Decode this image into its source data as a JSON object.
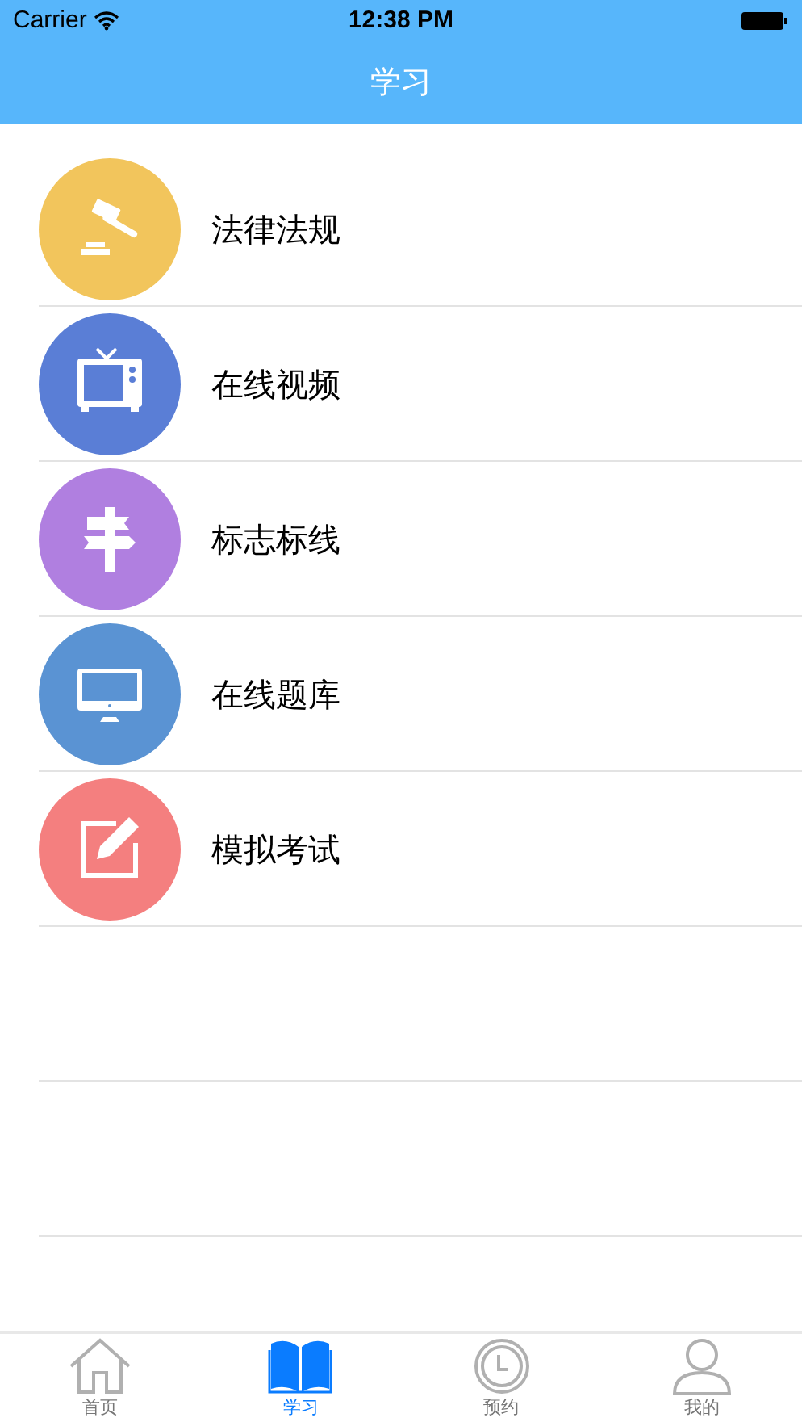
{
  "status_bar": {
    "carrier": "Carrier",
    "time": "12:38 PM"
  },
  "nav": {
    "title": "学习"
  },
  "items": [
    {
      "label": "法律法规",
      "kind": "gavel",
      "color": "#f2c55c"
    },
    {
      "label": "在线视频",
      "kind": "tv",
      "color": "#5a7ed6"
    },
    {
      "label": "标志标线",
      "kind": "signpost",
      "color": "#b07fe0"
    },
    {
      "label": "在线题库",
      "kind": "monitor",
      "color": "#5a93d3"
    },
    {
      "label": "模拟考试",
      "kind": "edit",
      "color": "#f47f7f"
    }
  ],
  "tabs": [
    {
      "label": "首页",
      "kind": "home",
      "selected": false
    },
    {
      "label": "学习",
      "kind": "book",
      "selected": true
    },
    {
      "label": "预约",
      "kind": "clock",
      "selected": false
    },
    {
      "label": "我的",
      "kind": "person",
      "selected": false
    }
  ]
}
